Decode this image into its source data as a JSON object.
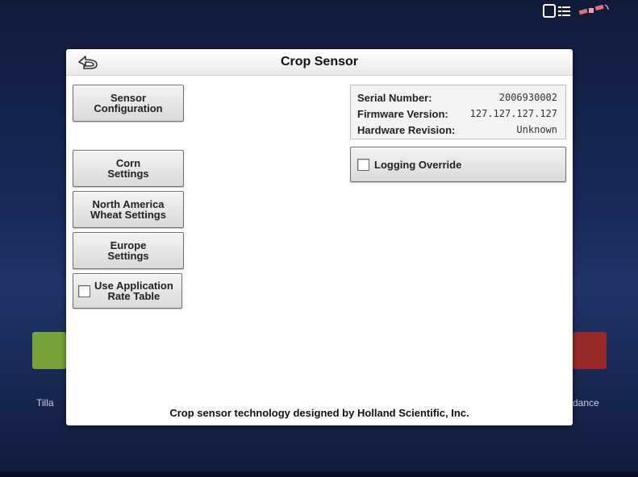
{
  "status": {
    "icons": [
      "display-icon",
      "satellite-icon"
    ]
  },
  "background": {
    "tile_left_label": "Tilla",
    "tile_right_label": "dance",
    "tile_left_color": "#7aa23a",
    "tile_right_color": "#9a2a2a"
  },
  "dialog": {
    "title": "Crop Sensor",
    "back_icon": "back-arrow-icon",
    "buttons": {
      "sensor_configuration": "Sensor\nConfiguration",
      "corn_settings": "Corn\nSettings",
      "na_wheat_settings": "North America\nWheat Settings",
      "europe_settings": "Europe\nSettings",
      "use_app_rate_table": "Use Application\nRate Table"
    },
    "info": {
      "serial_label": "Serial Number:",
      "serial_value": "2006930002",
      "firmware_label": "Firmware Version:",
      "firmware_value": "127.127.127.127",
      "hardware_label": "Hardware Revision:",
      "hardware_value": "Unknown"
    },
    "logging_override": {
      "label": "Logging Override",
      "checked": false
    },
    "use_app_rate_table_checked": false,
    "footer": "Crop sensor technology designed by Holland Scientific, Inc."
  }
}
